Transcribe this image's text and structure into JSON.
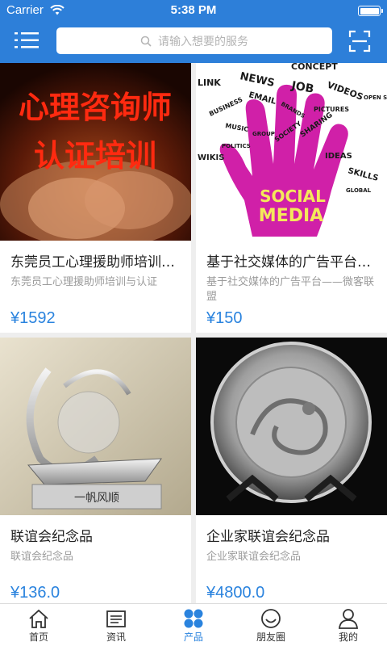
{
  "status_bar": {
    "carrier": "Carrier",
    "time": "5:38 PM"
  },
  "header": {
    "search_placeholder": "请输入想要的服务"
  },
  "products": [
    {
      "image_text": [
        "心理咨询师",
        "认证培训"
      ],
      "title": "东莞员工心理援助师培训与认证",
      "desc": "东莞员工心理援助师培训与认证",
      "price": "¥1592"
    },
    {
      "image_text": [
        "LINK",
        "NEWS",
        "EMAIL",
        "JOB",
        "CONCEPT",
        "VIDEOS",
        "OPEN SOURCE",
        "BUSINESS",
        "BRANDS",
        "PICTURES",
        "MUSIC",
        "GROUP",
        "SOCIETY",
        "SHARING",
        "POLITICS",
        "WIKIS",
        "IDEAS",
        "SKILLS",
        "GLOBAL",
        "SOCIAL",
        "MEDIA"
      ],
      "title": "基于社交媒体的广告平台——微客联盟",
      "desc": "基于社交媒体的广告平台——微客联盟",
      "price": "¥150"
    },
    {
      "image_text": [
        "一帆风顺"
      ],
      "title": "联谊会纪念品",
      "desc": "联谊会纪念品",
      "price": "¥136.0"
    },
    {
      "title": "企业家联谊会纪念品",
      "desc": "企业家联谊会纪念品",
      "price": "¥4800.0"
    }
  ],
  "tabs": [
    {
      "label": "首页",
      "icon": "home-icon"
    },
    {
      "label": "资讯",
      "icon": "news-icon"
    },
    {
      "label": "产品",
      "icon": "product-icon",
      "active": true
    },
    {
      "label": "朋友圈",
      "icon": "friends-icon"
    },
    {
      "label": "我的",
      "icon": "profile-icon"
    }
  ],
  "colors": {
    "brand": "#2d7fd9",
    "accent": "#2a83de",
    "background": "#eeeeee"
  }
}
